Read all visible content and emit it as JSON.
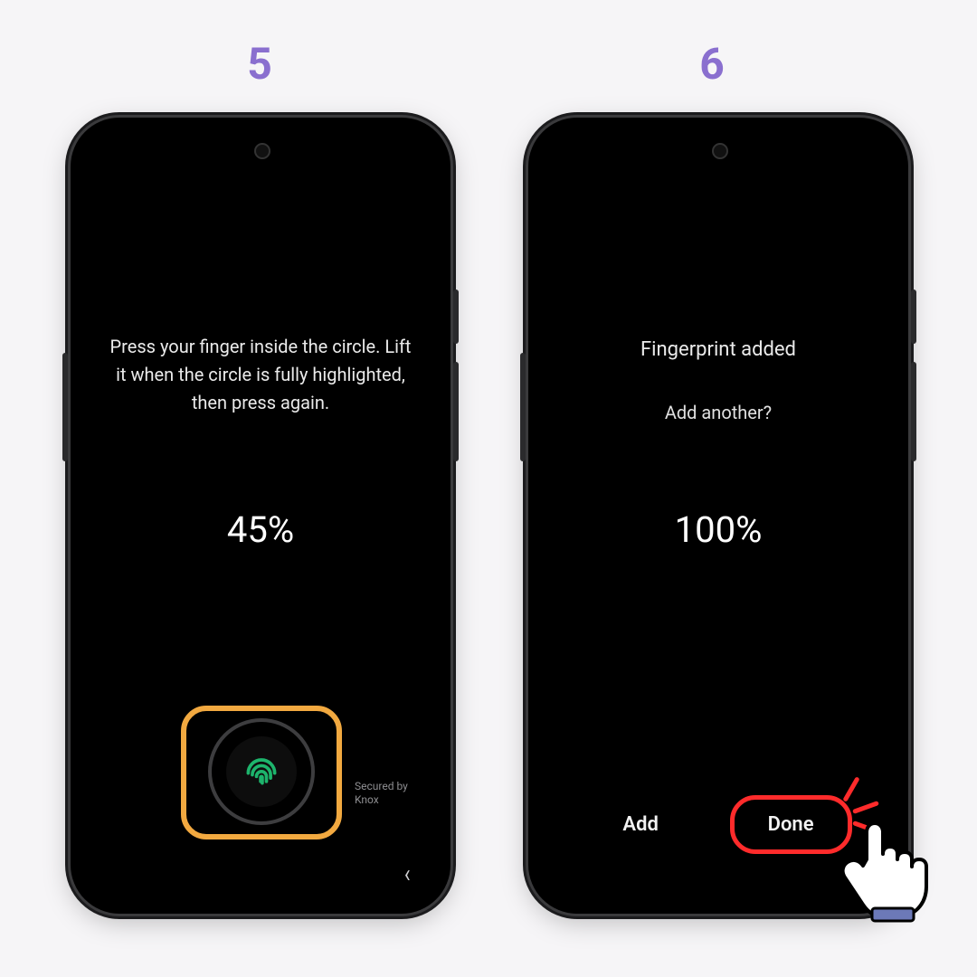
{
  "steps": {
    "left_number": "5",
    "right_number": "6"
  },
  "phone5": {
    "instruction": "Press your finger inside the circle. Lift it when the circle is fully highlighted, then press again.",
    "progress": "45%",
    "secured_line1": "Secured by",
    "secured_line2": "Knox"
  },
  "phone6": {
    "title": "Fingerprint added",
    "subtitle": "Add another?",
    "progress": "100%",
    "add_label": "Add",
    "done_label": "Done"
  },
  "colors": {
    "step_number": "#8a6fcf",
    "highlight_orange": "#f2a940",
    "highlight_red": "#ff2b2b",
    "fingerprint_green": "#1db46c"
  }
}
